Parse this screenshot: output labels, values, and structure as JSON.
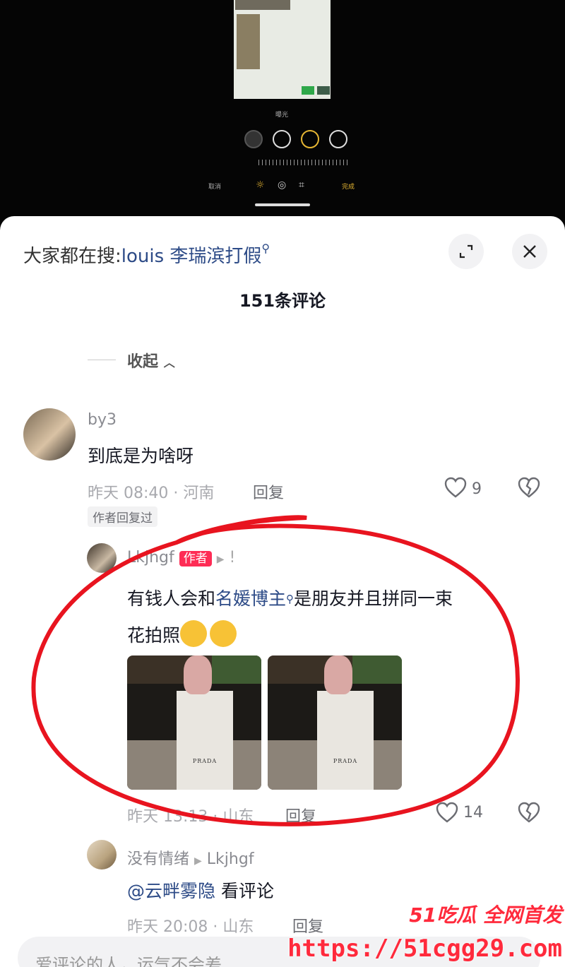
{
  "editor": {
    "mini_label": "曝光",
    "cancel": "取消",
    "done": "完成"
  },
  "header": {
    "search_prefix": "大家都在搜:",
    "search_keyword": "louis 李瑞滨打假",
    "comment_count": "151条评论",
    "collapse": "收起"
  },
  "comments": [
    {
      "user": "by3",
      "text": "到底是为啥呀",
      "meta": "昨天 08:40 · 河南",
      "reply": "回复",
      "likes": "9",
      "tag": "作者回复过"
    }
  ],
  "author_reply": {
    "user": "Lkjhgf",
    "badge": "作者",
    "text_before": "有钱人会和",
    "keyword": "名媛博主",
    "text_after": "是朋友并且拼同一束",
    "text_line2": "花拍照",
    "meta": "昨天 13:13 · 山东",
    "reply": "回复",
    "likes": "14",
    "photo_label": "PRADA"
  },
  "sub_reply": {
    "user": "没有情绪",
    "to": "Lkjhgf",
    "mention": "@云畔雾隐",
    "text": " 看评论",
    "meta": "昨天 20:08 · 山东",
    "reply": "回复"
  },
  "input": {
    "placeholder": "爱评论的人，运气不会差"
  },
  "watermark": {
    "brand": "51吃瓜 全网首发",
    "url": "https://51cgg29.com"
  },
  "colors": {
    "accent": "#fe2c55",
    "keyword": "#2d4b87",
    "annotation": "#e8141f"
  }
}
